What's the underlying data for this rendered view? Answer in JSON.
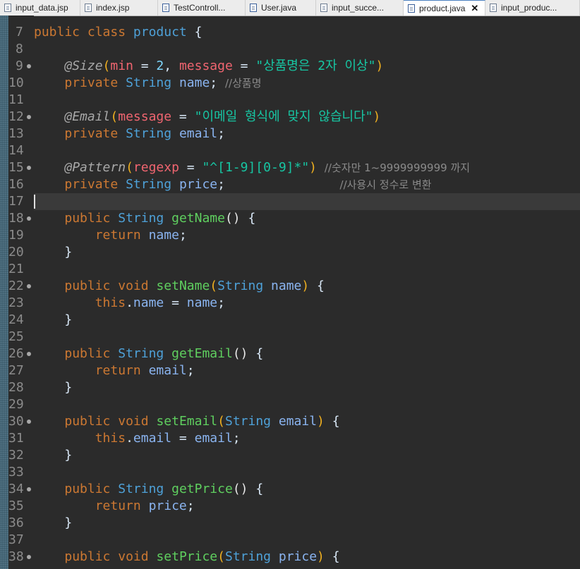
{
  "tabs": [
    {
      "label": "input_data.jsp",
      "icon": "jsp-file-icon",
      "active": false
    },
    {
      "label": "index.jsp",
      "icon": "jsp-file-icon",
      "active": false
    },
    {
      "label": "TestControll...",
      "icon": "java-file-icon",
      "active": false
    },
    {
      "label": "User.java",
      "icon": "java-file-icon",
      "active": false
    },
    {
      "label": "input_succe...",
      "icon": "jsp-file-icon",
      "active": false
    },
    {
      "label": "product.java",
      "icon": "java-file-icon",
      "active": true,
      "close": "✕"
    },
    {
      "label": "input_produc...",
      "icon": "jsp-file-icon",
      "active": false
    }
  ],
  "editor": {
    "current_line": "17",
    "lines": [
      {
        "n": "7",
        "tokens": [
          [
            "kw",
            "public"
          ],
          [
            "op",
            " "
          ],
          [
            "kw",
            "class"
          ],
          [
            "op",
            " "
          ],
          [
            "type",
            "product"
          ],
          [
            "op",
            " {"
          ]
        ]
      },
      {
        "n": "8",
        "tokens": []
      },
      {
        "n": "9",
        "fold": true,
        "tokens": [
          [
            "op",
            "    "
          ],
          [
            "ann",
            "@Size"
          ],
          [
            "pl",
            "("
          ],
          [
            "akey",
            "min"
          ],
          [
            "op",
            " = "
          ],
          [
            "num",
            "2"
          ],
          [
            "op",
            ", "
          ],
          [
            "akey",
            "message"
          ],
          [
            "op",
            " = "
          ],
          [
            "str",
            "\"상품명은 2자 이상\""
          ],
          [
            "pl",
            ")"
          ]
        ]
      },
      {
        "n": "10",
        "tokens": [
          [
            "op",
            "    "
          ],
          [
            "kw",
            "private"
          ],
          [
            "op",
            " "
          ],
          [
            "type",
            "String"
          ],
          [
            "op",
            " "
          ],
          [
            "fld",
            "name"
          ],
          [
            "op",
            "; "
          ],
          [
            "cmt",
            "//상품명"
          ]
        ]
      },
      {
        "n": "11",
        "tokens": []
      },
      {
        "n": "12",
        "fold": true,
        "tokens": [
          [
            "op",
            "    "
          ],
          [
            "ann",
            "@Email"
          ],
          [
            "pl",
            "("
          ],
          [
            "akey",
            "message"
          ],
          [
            "op",
            " = "
          ],
          [
            "str",
            "\"이메일 형식에 맞지 않습니다\""
          ],
          [
            "pl",
            ")"
          ]
        ]
      },
      {
        "n": "13",
        "tokens": [
          [
            "op",
            "    "
          ],
          [
            "kw",
            "private"
          ],
          [
            "op",
            " "
          ],
          [
            "type",
            "String"
          ],
          [
            "op",
            " "
          ],
          [
            "fld",
            "email"
          ],
          [
            "op",
            ";"
          ]
        ]
      },
      {
        "n": "14",
        "tokens": []
      },
      {
        "n": "15",
        "fold": true,
        "tokens": [
          [
            "op",
            "    "
          ],
          [
            "ann",
            "@Pattern"
          ],
          [
            "pl",
            "("
          ],
          [
            "akey",
            "regexp"
          ],
          [
            "op",
            " = "
          ],
          [
            "str",
            "\"^[1-9][0-9]*\""
          ],
          [
            "pl",
            ")"
          ],
          [
            "op",
            " "
          ],
          [
            "cmt",
            "//숫자만 1~9999999999 까지"
          ]
        ]
      },
      {
        "n": "16",
        "tokens": [
          [
            "op",
            "    "
          ],
          [
            "kw",
            "private"
          ],
          [
            "op",
            " "
          ],
          [
            "type",
            "String"
          ],
          [
            "op",
            " "
          ],
          [
            "fld",
            "price"
          ],
          [
            "op",
            ";               "
          ],
          [
            "cmt",
            "//사용시 정수로 변환"
          ]
        ]
      },
      {
        "n": "17",
        "tokens": []
      },
      {
        "n": "18",
        "fold": true,
        "tokens": [
          [
            "op",
            "    "
          ],
          [
            "kw",
            "public"
          ],
          [
            "op",
            " "
          ],
          [
            "type",
            "String"
          ],
          [
            "op",
            " "
          ],
          [
            "fn",
            "getName"
          ],
          [
            "pl2",
            "()"
          ],
          [
            "op",
            " {"
          ]
        ]
      },
      {
        "n": "19",
        "tokens": [
          [
            "op",
            "        "
          ],
          [
            "kw",
            "return"
          ],
          [
            "op",
            " "
          ],
          [
            "fld",
            "name"
          ],
          [
            "op",
            ";"
          ]
        ]
      },
      {
        "n": "20",
        "tokens": [
          [
            "op",
            "    }"
          ]
        ]
      },
      {
        "n": "21",
        "tokens": []
      },
      {
        "n": "22",
        "fold": true,
        "tokens": [
          [
            "op",
            "    "
          ],
          [
            "kw",
            "public"
          ],
          [
            "op",
            " "
          ],
          [
            "kw",
            "void"
          ],
          [
            "op",
            " "
          ],
          [
            "fn",
            "setName"
          ],
          [
            "pl",
            "("
          ],
          [
            "type",
            "String"
          ],
          [
            "op",
            " "
          ],
          [
            "par",
            "name"
          ],
          [
            "pl",
            ")"
          ],
          [
            "op",
            " {"
          ]
        ]
      },
      {
        "n": "23",
        "tokens": [
          [
            "op",
            "        "
          ],
          [
            "kw",
            "this"
          ],
          [
            "op",
            "."
          ],
          [
            "fld",
            "name"
          ],
          [
            "op",
            " = "
          ],
          [
            "par",
            "name"
          ],
          [
            "op",
            ";"
          ]
        ]
      },
      {
        "n": "24",
        "tokens": [
          [
            "op",
            "    }"
          ]
        ]
      },
      {
        "n": "25",
        "tokens": []
      },
      {
        "n": "26",
        "fold": true,
        "tokens": [
          [
            "op",
            "    "
          ],
          [
            "kw",
            "public"
          ],
          [
            "op",
            " "
          ],
          [
            "type",
            "String"
          ],
          [
            "op",
            " "
          ],
          [
            "fn",
            "getEmail"
          ],
          [
            "pl2",
            "()"
          ],
          [
            "op",
            " {"
          ]
        ]
      },
      {
        "n": "27",
        "tokens": [
          [
            "op",
            "        "
          ],
          [
            "kw",
            "return"
          ],
          [
            "op",
            " "
          ],
          [
            "fld",
            "email"
          ],
          [
            "op",
            ";"
          ]
        ]
      },
      {
        "n": "28",
        "tokens": [
          [
            "op",
            "    }"
          ]
        ]
      },
      {
        "n": "29",
        "tokens": []
      },
      {
        "n": "30",
        "fold": true,
        "tokens": [
          [
            "op",
            "    "
          ],
          [
            "kw",
            "public"
          ],
          [
            "op",
            " "
          ],
          [
            "kw",
            "void"
          ],
          [
            "op",
            " "
          ],
          [
            "fn",
            "setEmail"
          ],
          [
            "pl",
            "("
          ],
          [
            "type",
            "String"
          ],
          [
            "op",
            " "
          ],
          [
            "par",
            "email"
          ],
          [
            "pl",
            ")"
          ],
          [
            "op",
            " {"
          ]
        ]
      },
      {
        "n": "31",
        "tokens": [
          [
            "op",
            "        "
          ],
          [
            "kw",
            "this"
          ],
          [
            "op",
            "."
          ],
          [
            "fld",
            "email"
          ],
          [
            "op",
            " = "
          ],
          [
            "par",
            "email"
          ],
          [
            "op",
            ";"
          ]
        ]
      },
      {
        "n": "32",
        "tokens": [
          [
            "op",
            "    }"
          ]
        ]
      },
      {
        "n": "33",
        "tokens": []
      },
      {
        "n": "34",
        "fold": true,
        "tokens": [
          [
            "op",
            "    "
          ],
          [
            "kw",
            "public"
          ],
          [
            "op",
            " "
          ],
          [
            "type",
            "String"
          ],
          [
            "op",
            " "
          ],
          [
            "fn",
            "getPrice"
          ],
          [
            "pl2",
            "()"
          ],
          [
            "op",
            " {"
          ]
        ]
      },
      {
        "n": "35",
        "tokens": [
          [
            "op",
            "        "
          ],
          [
            "kw",
            "return"
          ],
          [
            "op",
            " "
          ],
          [
            "fld",
            "price"
          ],
          [
            "op",
            ";"
          ]
        ]
      },
      {
        "n": "36",
        "tokens": [
          [
            "op",
            "    }"
          ]
        ]
      },
      {
        "n": "37",
        "tokens": []
      },
      {
        "n": "38",
        "fold": true,
        "tokens": [
          [
            "op",
            "    "
          ],
          [
            "kw",
            "public"
          ],
          [
            "op",
            " "
          ],
          [
            "kw",
            "void"
          ],
          [
            "op",
            " "
          ],
          [
            "fn",
            "setPrice"
          ],
          [
            "pl",
            "("
          ],
          [
            "type",
            "String"
          ],
          [
            "op",
            " "
          ],
          [
            "par",
            "price"
          ],
          [
            "pl",
            ")"
          ],
          [
            "op",
            " {"
          ]
        ]
      }
    ]
  }
}
